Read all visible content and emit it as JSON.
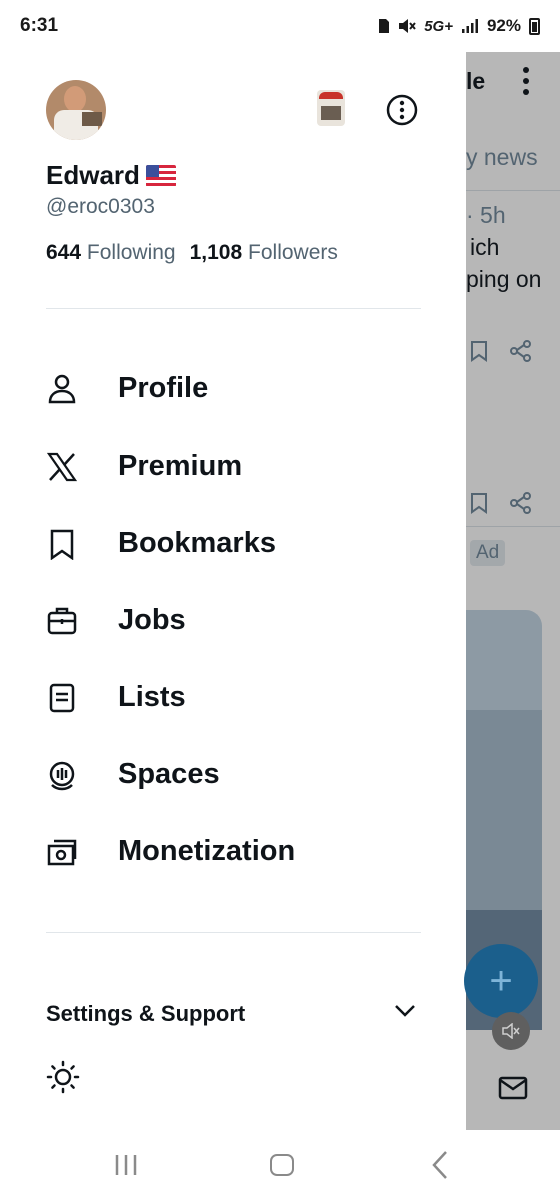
{
  "status_bar": {
    "time": "6:31",
    "network": "5G+",
    "battery": "92%"
  },
  "drawer": {
    "profile": {
      "name": "Edward",
      "handle": "@eroc0303",
      "following_count": "644",
      "following_label": "Following",
      "followers_count": "1,108",
      "followers_label": "Followers"
    },
    "menu": [
      {
        "label": "Profile",
        "icon": "person-icon"
      },
      {
        "label": "Premium",
        "icon": "x-logo-icon"
      },
      {
        "label": "Bookmarks",
        "icon": "bookmark-icon"
      },
      {
        "label": "Jobs",
        "icon": "briefcase-icon"
      },
      {
        "label": "Lists",
        "icon": "list-icon"
      },
      {
        "label": "Spaces",
        "icon": "spaces-icon"
      },
      {
        "label": "Monetization",
        "icon": "money-icon"
      }
    ],
    "settings_label": "Settings & Support"
  },
  "background": {
    "header_fragment": "le",
    "tab_fragment": "y news",
    "time_fragment": "· 5h",
    "text_line1": "ich",
    "text_line2": "ping on",
    "ad_label": "Ad"
  },
  "colors": {
    "text": "#0f1419",
    "secondary": "#536471",
    "divider": "#e1e6ea",
    "dim_overlay": "#b7b7b7",
    "fab": "#1b5f8c"
  }
}
